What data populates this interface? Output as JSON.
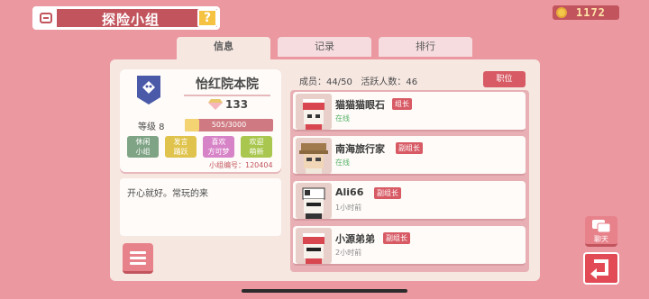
{
  "header": {
    "title": "探险小组",
    "help_icon": "?",
    "coins": "1172"
  },
  "tabs": [
    {
      "label": "信息",
      "active": true
    },
    {
      "label": "记录",
      "active": false
    },
    {
      "label": "排行",
      "active": false
    }
  ],
  "group": {
    "name": "怡红院本院",
    "honor": "133",
    "level_label": "等级 8",
    "xp_text": "505/3000",
    "xp_fraction": 0.168,
    "tags": [
      {
        "text": "休闲\n小组",
        "color": "#7fa385"
      },
      {
        "text": "发言\n踊跃",
        "color": "#e0c34c"
      },
      {
        "text": "喜欢\n方可梦",
        "color": "#d783c7"
      },
      {
        "text": "欢迎\n萌新",
        "color": "#a9c74f"
      }
    ],
    "id_text": "小组编号：120404",
    "description": "开心就好。常玩的来"
  },
  "members_header": {
    "count": "成员：44/50",
    "active": "活跃人数：46",
    "role_button": "职位"
  },
  "members": [
    {
      "name": "猫猫猫眼石",
      "role": "组长",
      "status": "在线",
      "status_color": "#58b368"
    },
    {
      "name": "南海旅行家",
      "role": "副组长",
      "status": "在线",
      "status_color": "#58b368"
    },
    {
      "name": "Ali66",
      "role": "副组长",
      "status": "1小时前",
      "status_color": "#8a8a8a"
    },
    {
      "name": "小源弟弟",
      "role": "副组长",
      "status": "2小时前",
      "status_color": "#8a8a8a"
    }
  ],
  "side": {
    "chat_label": "聊天"
  }
}
